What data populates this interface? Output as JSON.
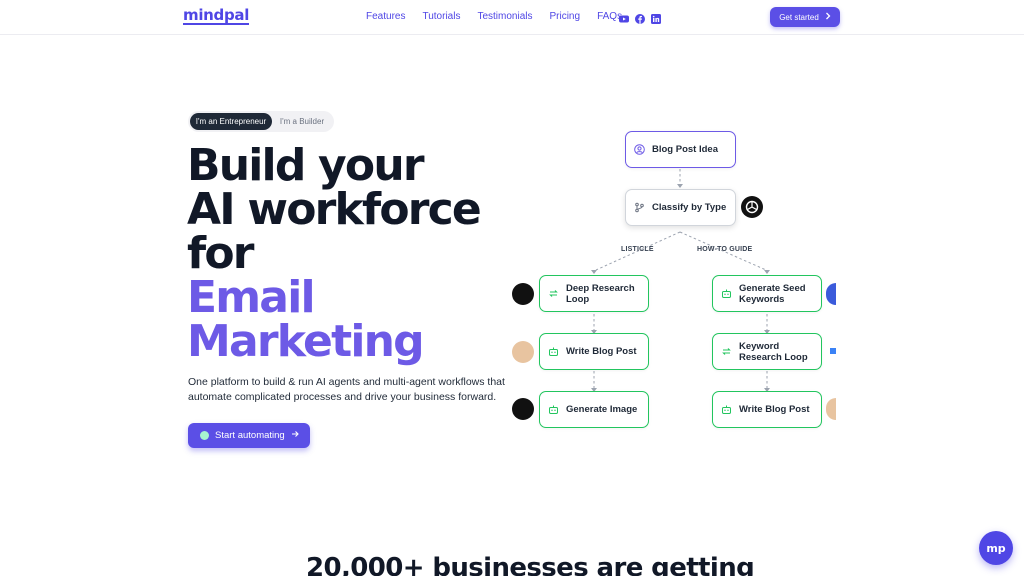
{
  "brand": {
    "logo": "mindpal",
    "accent": "#5b4fe6",
    "success": "#22c55e"
  },
  "nav": {
    "links": [
      "Features",
      "Tutorials",
      "Testimonials",
      "Pricing",
      "FAQs"
    ],
    "social_icons": [
      "youtube-icon",
      "facebook-icon",
      "linkedin-icon"
    ],
    "cta_label": "Get started"
  },
  "hero": {
    "toggle": {
      "options": [
        "I'm an Entrepreneur",
        "I'm a Builder"
      ],
      "selected": "I'm an Entrepreneur"
    },
    "headline_lines": [
      "Build your",
      "AI workforce",
      "for"
    ],
    "headline_accent_lines": [
      "Email",
      "Marketing"
    ],
    "subtext": "One platform to build & run AI agents and multi-agent workflows that automate complicated processes and drive your business forward.",
    "cta_label": "Start automating"
  },
  "workflow": {
    "trigger": "Blog Post Idea",
    "router": "Classify by Type",
    "branches": [
      {
        "label": "LISTICLE",
        "steps": [
          "Deep Research Loop",
          "Write Blog Post",
          "Generate Image"
        ]
      },
      {
        "label": "HOW-TO GUIDE",
        "steps": [
          "Generate Seed Keywords",
          "Keyword Research Loop",
          "Write Blog Post"
        ]
      }
    ]
  },
  "bottom": {
    "heading": "20,000+ businesses are getting",
    "chat_label": "mp"
  }
}
